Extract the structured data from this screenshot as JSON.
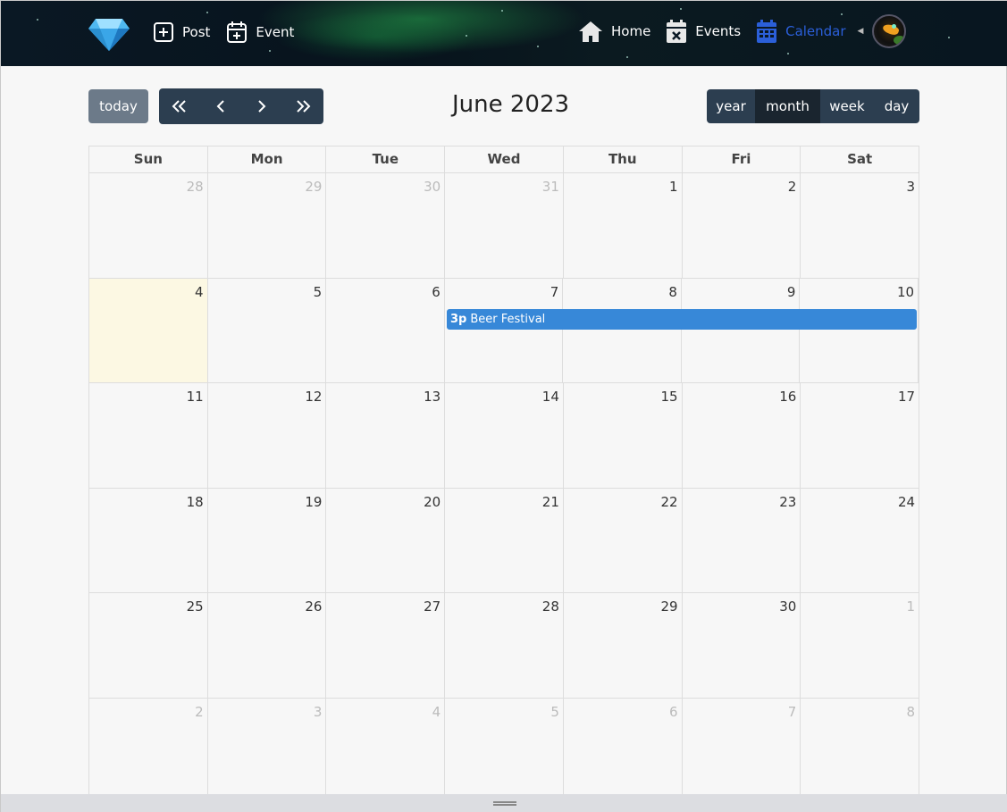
{
  "header": {
    "left_nav": [
      {
        "label": "Post",
        "icon": "plus-square-icon"
      },
      {
        "label": "Event",
        "icon": "calendar-plus-icon"
      }
    ],
    "right_nav": [
      {
        "label": "Home",
        "icon": "home-icon",
        "active": false
      },
      {
        "label": "Events",
        "icon": "calendar-x-icon",
        "active": false
      },
      {
        "label": "Calendar",
        "icon": "calendar-icon",
        "active": true
      }
    ],
    "colors": {
      "active": "#2b5fd9",
      "event": "#3788d8",
      "today_bg": "#fcf8e3"
    }
  },
  "toolbar": {
    "today_label": "today",
    "title": "June 2023",
    "views": [
      "year",
      "month",
      "week",
      "day"
    ],
    "active_view": "month"
  },
  "calendar": {
    "weekdays": [
      "Sun",
      "Mon",
      "Tue",
      "Wed",
      "Thu",
      "Fri",
      "Sat"
    ],
    "weeks": [
      [
        {
          "d": "28",
          "o": true
        },
        {
          "d": "29",
          "o": true
        },
        {
          "d": "30",
          "o": true
        },
        {
          "d": "31",
          "o": true
        },
        {
          "d": "1"
        },
        {
          "d": "2"
        },
        {
          "d": "3"
        }
      ],
      [
        {
          "d": "4",
          "t": true
        },
        {
          "d": "5"
        },
        {
          "d": "6"
        },
        {
          "d": "7"
        },
        {
          "d": "8"
        },
        {
          "d": "9"
        },
        {
          "d": "10"
        }
      ],
      [
        {
          "d": "11"
        },
        {
          "d": "12"
        },
        {
          "d": "13"
        },
        {
          "d": "14"
        },
        {
          "d": "15"
        },
        {
          "d": "16"
        },
        {
          "d": "17"
        }
      ],
      [
        {
          "d": "18"
        },
        {
          "d": "19"
        },
        {
          "d": "20"
        },
        {
          "d": "21"
        },
        {
          "d": "22"
        },
        {
          "d": "23"
        },
        {
          "d": "24"
        }
      ],
      [
        {
          "d": "25"
        },
        {
          "d": "26"
        },
        {
          "d": "27"
        },
        {
          "d": "28"
        },
        {
          "d": "29"
        },
        {
          "d": "30"
        },
        {
          "d": "1",
          "o": true
        }
      ],
      [
        {
          "d": "2",
          "o": true
        },
        {
          "d": "3",
          "o": true
        },
        {
          "d": "4",
          "o": true
        },
        {
          "d": "5",
          "o": true
        },
        {
          "d": "6",
          "o": true
        },
        {
          "d": "7",
          "o": true
        },
        {
          "d": "8",
          "o": true
        }
      ]
    ],
    "events": [
      {
        "time": "3p",
        "title": "Beer Festival",
        "start": "Wed 7",
        "end": "Sat 10"
      }
    ]
  }
}
